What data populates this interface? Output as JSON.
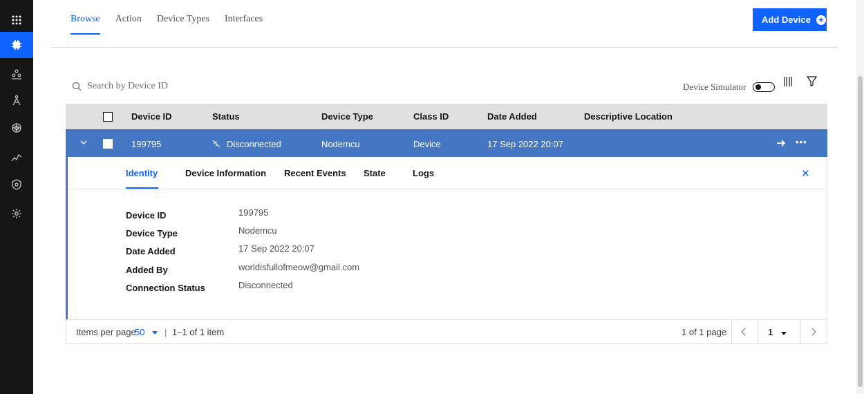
{
  "colors": {
    "accent": "#0f62fe",
    "row_selected": "#4377c4",
    "rail_bg": "#161616"
  },
  "rail": {
    "items": [
      {
        "icon": "app-switcher-icon"
      },
      {
        "icon": "chip-icon",
        "active": true
      },
      {
        "icon": "members-icon"
      },
      {
        "icon": "rules-icon"
      },
      {
        "icon": "analytics-icon"
      },
      {
        "icon": "usage-chart-icon"
      },
      {
        "icon": "security-icon"
      },
      {
        "icon": "settings-icon"
      }
    ]
  },
  "tabs": [
    "Browse",
    "Action",
    "Device Types",
    "Interfaces"
  ],
  "add_device_label": "Add Device",
  "search_placeholder": "Search by Device ID",
  "device_simulator_label": "Device Simulator",
  "table": {
    "headers": [
      "Device ID",
      "Status",
      "Device Type",
      "Class ID",
      "Date Added",
      "Descriptive Location"
    ],
    "row": {
      "device_id": "199795",
      "status": "Disconnected",
      "device_type": "Nodemcu",
      "class_id": "Device",
      "date_added": "17 Sep 2022 20:07",
      "more": "•••"
    }
  },
  "detail": {
    "tabs": [
      "Identity",
      "Device Information",
      "Recent Events",
      "State",
      "Logs"
    ],
    "fields": [
      {
        "label": "Device ID",
        "value": "199795"
      },
      {
        "label": "Device Type",
        "value": "Nodemcu"
      },
      {
        "label": "Date Added",
        "value": "17 Sep 2022 20:07"
      },
      {
        "label": "Added By",
        "value": "worldisfullofmeow@gmail.com"
      },
      {
        "label": "Connection Status",
        "value": "Disconnected"
      }
    ]
  },
  "pagination": {
    "items_per_page_label": "Items per page",
    "items_per_page": "50",
    "range": "1–1 of 1 item",
    "pages_text": "1 of 1 page",
    "current_page": "1"
  }
}
